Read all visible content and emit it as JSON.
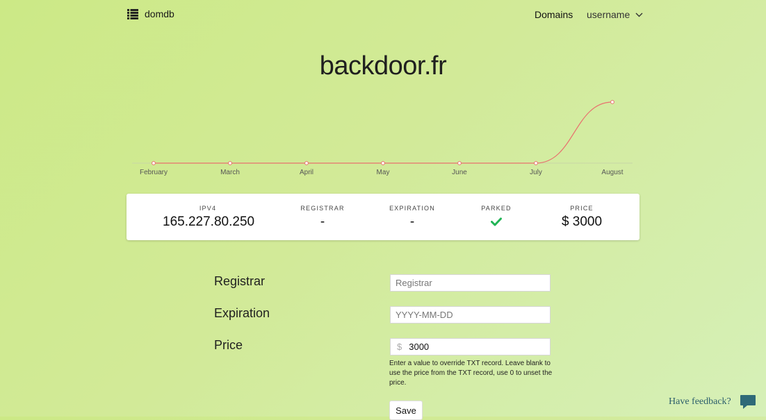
{
  "header": {
    "brand": "domdb",
    "brand_icon": "list-icon",
    "nav_domains": "Domains",
    "user_menu": "username"
  },
  "page": {
    "title": "backdoor.fr"
  },
  "chart_data": {
    "type": "line",
    "title": "",
    "x": [
      "February",
      "March",
      "April",
      "May",
      "June",
      "July",
      "August"
    ],
    "series": [
      {
        "values": [
          0,
          0,
          0,
          0,
          0,
          0,
          3000
        ],
        "color": "#e8716e"
      }
    ],
    "ylim": [
      0,
      3000
    ],
    "grid": false
  },
  "stats": [
    {
      "label": "IPV4",
      "value": "165.227.80.250"
    },
    {
      "label": "REGISTRAR",
      "value": "-"
    },
    {
      "label": "EXPIRATION",
      "value": "-"
    },
    {
      "label": "PARKED",
      "value": "check-icon",
      "color": "#20b455"
    },
    {
      "label": "PRICE",
      "value": "$ 3000"
    }
  ],
  "form": {
    "registrar_label": "Registrar",
    "registrar_placeholder": "Registrar",
    "registrar_value": "",
    "expiration_label": "Expiration",
    "expiration_placeholder": "YYYY-MM-DD",
    "expiration_value": "",
    "price_label": "Price",
    "price_prefix": "$",
    "price_value": "3000",
    "price_help": "Enter a value to override TXT record. Leave blank to use the price from the TXT record, use 0 to unset the price.",
    "save_label": "Save"
  },
  "feedback": {
    "label": "Have feedback?",
    "icon": "speech-bubble-icon"
  }
}
